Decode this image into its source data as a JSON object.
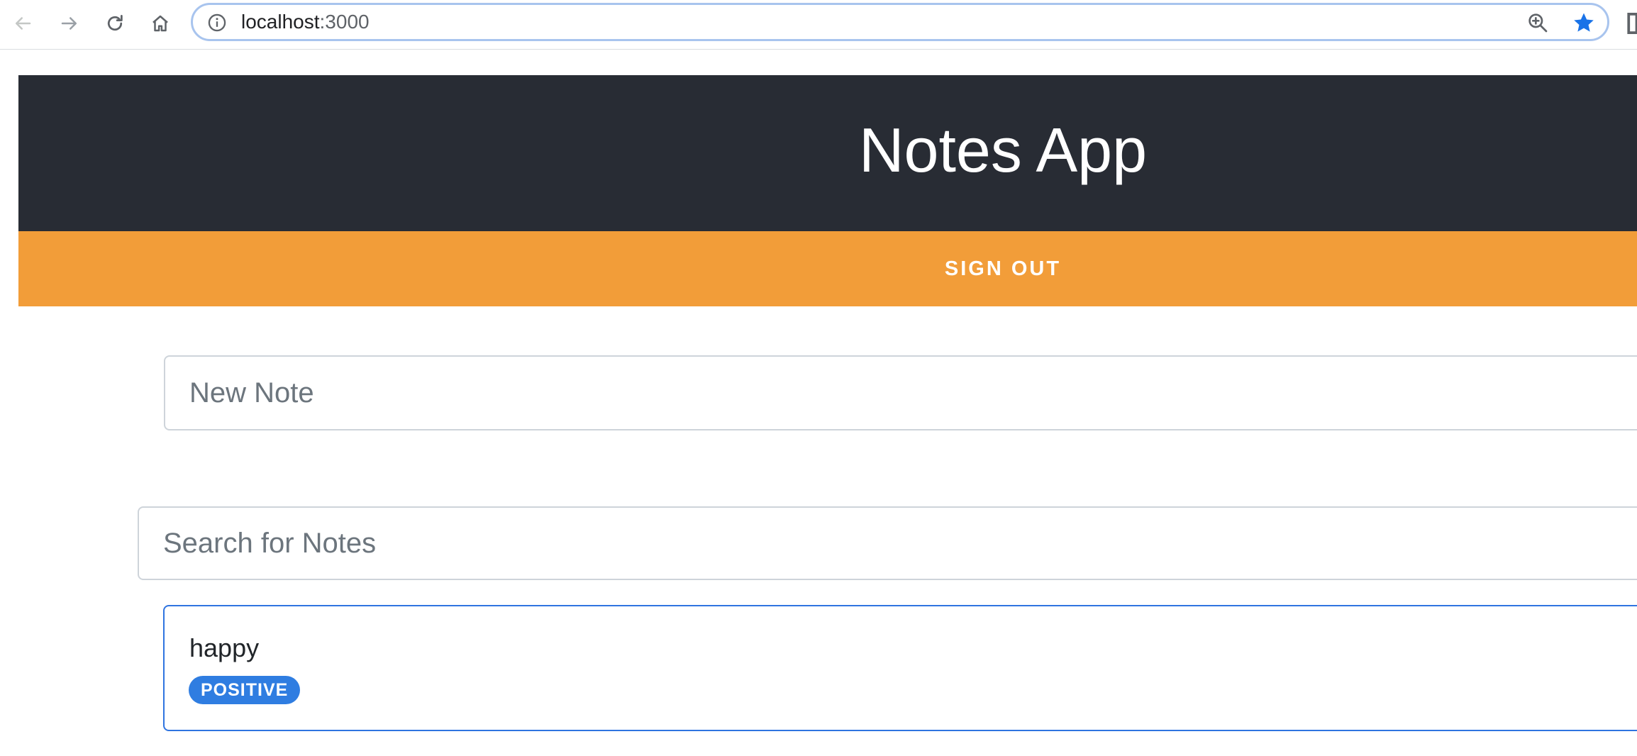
{
  "browser": {
    "url_host": "localhost",
    "url_port": ":3000",
    "icons": {
      "back": "back-arrow-icon",
      "forward": "forward-arrow-icon",
      "reload": "reload-icon",
      "home": "home-icon",
      "info": "info-icon",
      "zoom": "zoom-icon",
      "bookmark": "star-icon"
    },
    "star_color": "#1a73e8"
  },
  "header": {
    "title": "Notes App",
    "background": "#282c34"
  },
  "signout": {
    "label": "SIGN OUT",
    "background": "#f29d39"
  },
  "new_note": {
    "placeholder": "New Note",
    "value": ""
  },
  "search": {
    "placeholder": "Search for Notes",
    "value": ""
  },
  "notes": [
    {
      "text": "happy",
      "sentiment": "POSITIVE",
      "badge_color": "#2f7de1"
    }
  ]
}
